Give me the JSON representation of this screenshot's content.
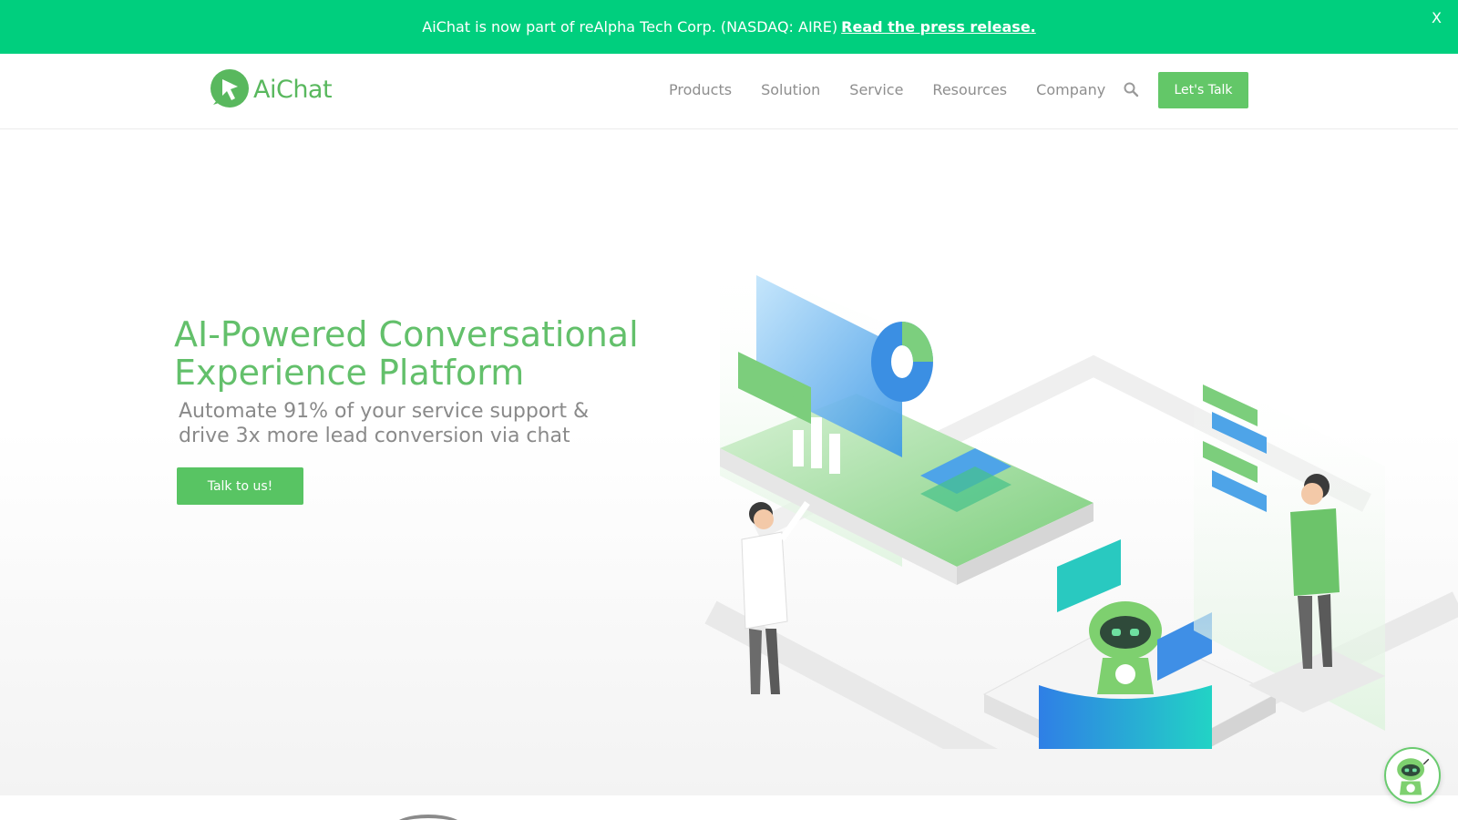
{
  "announcement": {
    "message": "AiChat is now part of reAlpha Tech Corp. (NASDAQ: AIRE)",
    "link_label": "Read the press release.",
    "close_label": "X"
  },
  "header": {
    "logo_text": "AiChat",
    "nav": [
      {
        "label": "Products"
      },
      {
        "label": "Solution"
      },
      {
        "label": "Service"
      },
      {
        "label": "Resources"
      },
      {
        "label": "Company"
      }
    ],
    "search_icon": "search-icon",
    "cta_label": "Let's Talk"
  },
  "hero": {
    "title_line1": "AI-Powered Conversational",
    "title_line2": "Experience Platform",
    "subtitle_line1": "Automate 91% of your service support &",
    "subtitle_line2": "drive 3x more lead conversion via chat",
    "button_label": "Talk to us!"
  },
  "colors": {
    "announce_bg": "#00cf7e",
    "brand_green": "#63c768",
    "accent_blue": "#3a8de0",
    "text_gray": "#8e8e8e"
  },
  "chatbot": {
    "icon": "robot-icon"
  }
}
